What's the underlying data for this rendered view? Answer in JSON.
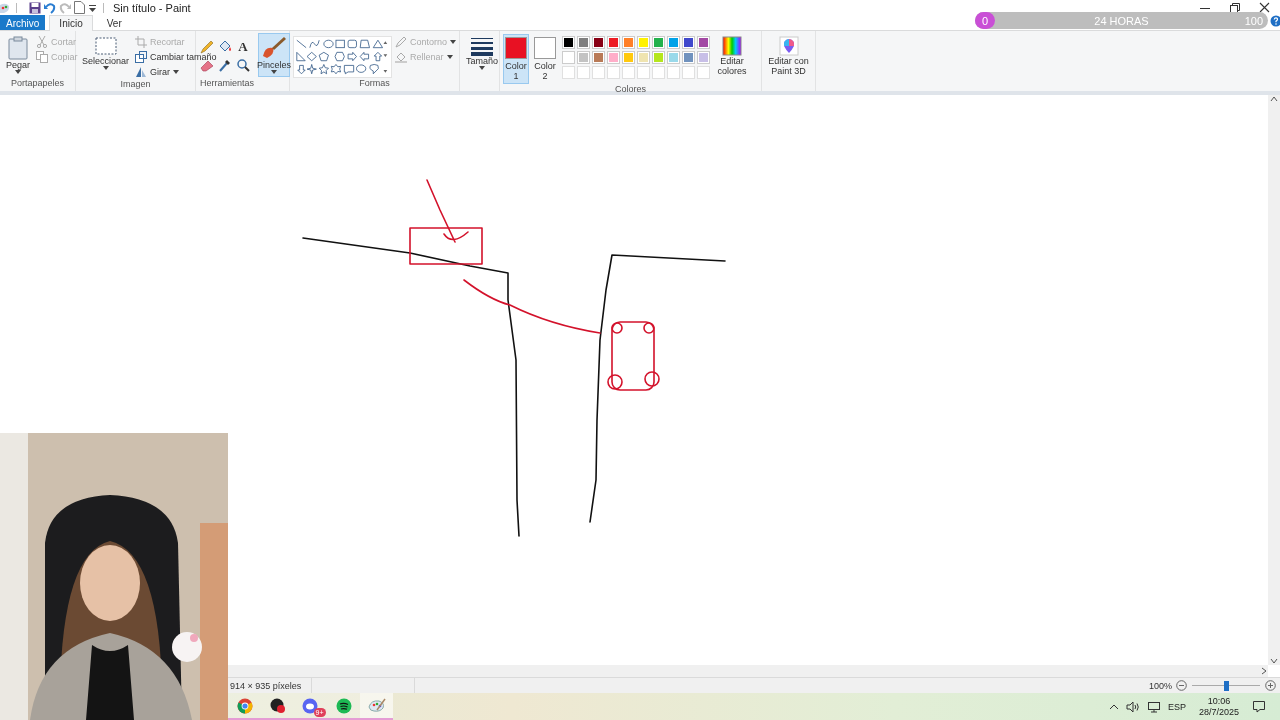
{
  "window": {
    "title": "Sin título - Paint"
  },
  "tabs": [
    {
      "label": "Archivo",
      "selected": false,
      "kind": "file"
    },
    {
      "label": "Inicio",
      "selected": true,
      "kind": "tab"
    },
    {
      "label": "Ver",
      "selected": false,
      "kind": "tab"
    }
  ],
  "ribbon": {
    "clipboard": {
      "label": "Portapapeles",
      "paste": {
        "label": "Pegar"
      },
      "cut": {
        "label": "Cortar",
        "disabled": true
      },
      "copy": {
        "label": "Copiar",
        "disabled": true
      }
    },
    "image": {
      "label": "Imagen",
      "select": {
        "label": "Seleccionar"
      },
      "crop": {
        "label": "Recortar",
        "disabled": true
      },
      "resize": {
        "label": "Cambiar tamaño",
        "disabled": false
      },
      "rotate": {
        "label": "Girar",
        "disabled": false
      }
    },
    "tools": {
      "label": "Herramientas",
      "text_glyph": "A"
    },
    "brushes": {
      "label": "Pinceles",
      "selected": true
    },
    "shapes": {
      "label": "Formas",
      "outline": {
        "label": "Contorno",
        "disabled": true
      },
      "fill": {
        "label": "Rellenar",
        "disabled": true
      }
    },
    "size": {
      "label": "Tamaño"
    },
    "colors": {
      "label": "Colores",
      "color1": {
        "label": "Color 1",
        "selected": true,
        "color": "#e81123"
      },
      "color2": {
        "label": "Color 2",
        "selected": false,
        "color": "#ffffff"
      },
      "palette": [
        {
          "kind": "swatch",
          "color": "#000000"
        },
        {
          "kind": "swatch",
          "color": "#7f7f7f"
        },
        {
          "kind": "swatch",
          "color": "#880015"
        },
        {
          "kind": "swatch",
          "color": "#ed1c24"
        },
        {
          "kind": "swatch",
          "color": "#ff7f27"
        },
        {
          "kind": "swatch",
          "color": "#fff200"
        },
        {
          "kind": "swatch",
          "color": "#22b14c"
        },
        {
          "kind": "swatch",
          "color": "#00a2e8"
        },
        {
          "kind": "swatch",
          "color": "#3f48cc"
        },
        {
          "kind": "swatch",
          "color": "#a349a4"
        },
        {
          "kind": "swatch",
          "color": "#ffffff"
        },
        {
          "kind": "swatch",
          "color": "#c3c3c3"
        },
        {
          "kind": "swatch",
          "color": "#b97a57"
        },
        {
          "kind": "swatch",
          "color": "#ffaec9"
        },
        {
          "kind": "swatch",
          "color": "#ffc90e"
        },
        {
          "kind": "swatch",
          "color": "#efe4b0"
        },
        {
          "kind": "swatch",
          "color": "#b5e61d"
        },
        {
          "kind": "swatch",
          "color": "#99d9ea"
        },
        {
          "kind": "swatch",
          "color": "#7092be"
        },
        {
          "kind": "swatch",
          "color": "#c8bfe7"
        },
        {
          "kind": "empty"
        },
        {
          "kind": "empty"
        },
        {
          "kind": "empty"
        },
        {
          "kind": "empty"
        },
        {
          "kind": "empty"
        },
        {
          "kind": "empty"
        },
        {
          "kind": "empty"
        },
        {
          "kind": "empty"
        },
        {
          "kind": "empty"
        },
        {
          "kind": "empty"
        }
      ],
      "edit_colors": {
        "label": "Editar colores"
      }
    },
    "paint3d": {
      "label": "Editar con Paint 3D"
    }
  },
  "timer": {
    "start": "0",
    "label": "24 HORAS",
    "end": "100",
    "level": 0
  },
  "status_bar": {
    "dimensions": "914 × 935 píxeles",
    "zoom": {
      "reading": "100%",
      "level": 0.5
    }
  },
  "taskbar": {
    "apps": [
      {
        "kind": "browser"
      },
      {
        "kind": "record"
      },
      {
        "kind": "chat",
        "badge": "9+"
      },
      {
        "kind": "music"
      },
      {
        "kind": "paint"
      }
    ],
    "tray": {
      "language": "ESP",
      "time": "10:06",
      "date": "28/7/2025"
    }
  }
}
